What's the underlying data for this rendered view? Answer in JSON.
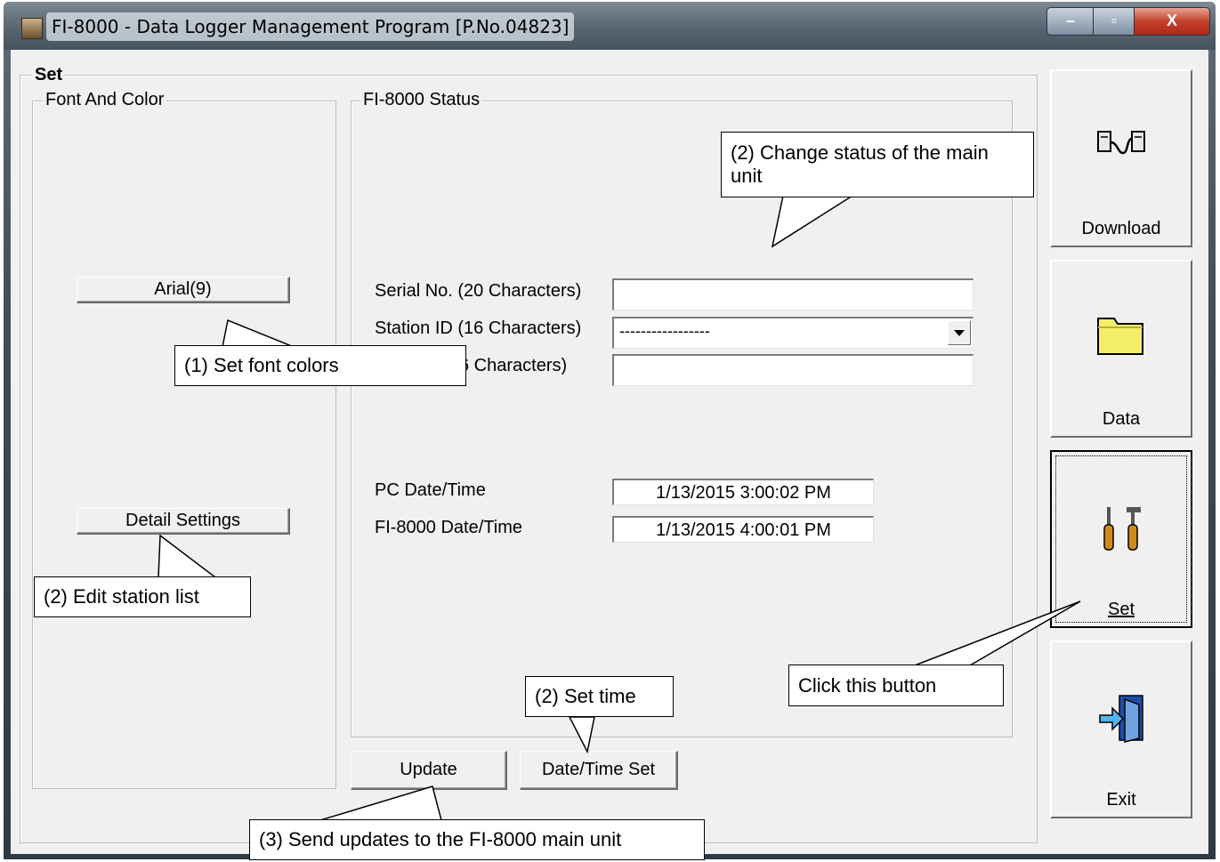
{
  "window": {
    "title": "FI-8000  - Data Logger Management Program [P.No.04823]",
    "controls": {
      "minimize": "–",
      "maximize": "▫",
      "close": "X"
    }
  },
  "set_group": {
    "label": "Set"
  },
  "font_group": {
    "label": "Font And Color",
    "font_button": "Arial(9)",
    "detail_button": "Detail Settings"
  },
  "status_group": {
    "label": "FI-8000 Status",
    "serial_label": "Serial No. (20 Characters)",
    "serial_value": "",
    "station_label": "Station ID (16 Characters)",
    "station_value": "-----------------",
    "name_label_visible": "6 Characters)",
    "name_value": "",
    "pc_time_label": "PC Date/Time",
    "pc_time_value": "1/13/2015 3:00:02 PM",
    "fi_time_label": "FI-8000 Date/Time",
    "fi_time_value": "1/13/2015 4:00:01 PM"
  },
  "bottom_buttons": {
    "update": "Update",
    "datetime_set": "Date/Time Set"
  },
  "side_buttons": {
    "download": "Download",
    "data": "Data",
    "set": "Set",
    "exit": "Exit"
  },
  "callouts": {
    "change_status": "(2) Change status of the main unit",
    "set_font": "(1) Set font colors",
    "edit_station": "(2) Edit station list",
    "set_time": "(2) Set time",
    "click_button": "Click this button",
    "send_updates": "(3) Send updates to the FI-8000 main unit"
  },
  "icons": {
    "download": "transfer-icon",
    "data": "folder-icon",
    "set": "tools-icon",
    "exit": "exit-door-icon",
    "dropdown": "chevron-down-icon"
  }
}
